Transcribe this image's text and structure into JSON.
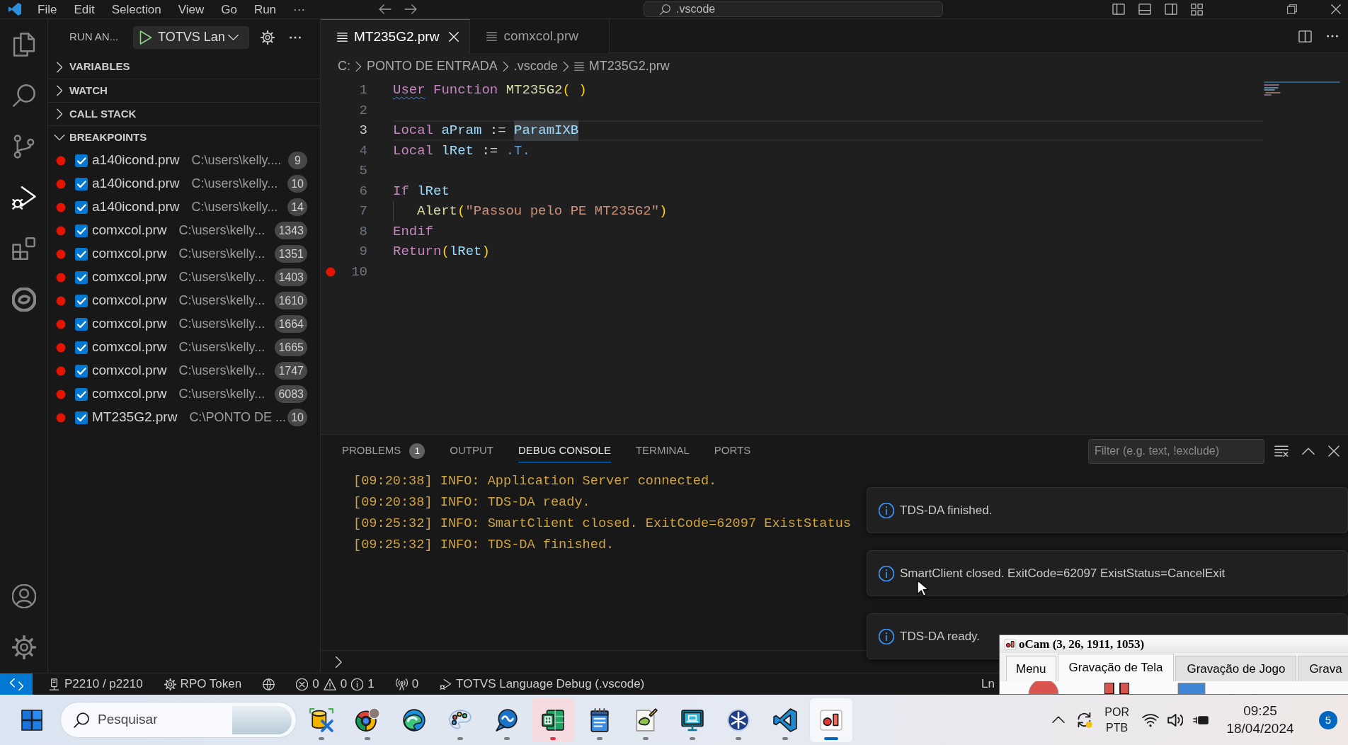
{
  "title_bar": {
    "menus": [
      "File",
      "Edit",
      "Selection",
      "View",
      "Go",
      "Run",
      "···"
    ],
    "command_center": ".vscode"
  },
  "activity_bar": {
    "top": [
      {
        "kind": "explorer",
        "selected": false
      },
      {
        "kind": "search",
        "selected": false
      },
      {
        "kind": "source_control",
        "selected": false
      },
      {
        "kind": "run_debug",
        "selected": true
      },
      {
        "kind": "extensions",
        "selected": false
      },
      {
        "kind": "totvs",
        "selected": false
      }
    ],
    "bottom": [
      {
        "kind": "accounts"
      },
      {
        "kind": "manage"
      }
    ]
  },
  "sidebar": {
    "title": "RUN AN...",
    "launch_config": "TOTVS Lan",
    "sections": [
      {
        "title": "VARIABLES",
        "expanded": false
      },
      {
        "title": "WATCH",
        "expanded": false
      },
      {
        "title": "CALL STACK",
        "expanded": false
      },
      {
        "title": "BREAKPOINTS",
        "expanded": true,
        "breakpoints": [
          {
            "file": "a140icond.prw",
            "path": "C:\\users\\kelly....",
            "line": "9",
            "checked": true
          },
          {
            "file": "a140icond.prw",
            "path": "C:\\users\\kelly...",
            "line": "10",
            "checked": true
          },
          {
            "file": "a140icond.prw",
            "path": "C:\\users\\kelly...",
            "line": "14",
            "checked": true
          },
          {
            "file": "comxcol.prw",
            "path": "C:\\users\\kelly...",
            "line": "1343",
            "checked": true
          },
          {
            "file": "comxcol.prw",
            "path": "C:\\users\\kelly...",
            "line": "1351",
            "checked": true
          },
          {
            "file": "comxcol.prw",
            "path": "C:\\users\\kelly...",
            "line": "1403",
            "checked": true
          },
          {
            "file": "comxcol.prw",
            "path": "C:\\users\\kelly...",
            "line": "1610",
            "checked": true
          },
          {
            "file": "comxcol.prw",
            "path": "C:\\users\\kelly...",
            "line": "1664",
            "checked": true
          },
          {
            "file": "comxcol.prw",
            "path": "C:\\users\\kelly...",
            "line": "1665",
            "checked": true
          },
          {
            "file": "comxcol.prw",
            "path": "C:\\users\\kelly...",
            "line": "1747",
            "checked": true
          },
          {
            "file": "comxcol.prw",
            "path": "C:\\users\\kelly...",
            "line": "6083",
            "checked": true
          },
          {
            "file": "MT235G2.prw",
            "path": "C:\\PONTO DE ...",
            "line": "10",
            "checked": true
          }
        ]
      }
    ]
  },
  "editor": {
    "tabs": [
      {
        "label": "MT235G2.prw",
        "selected": true
      },
      {
        "label": "comxcol.prw",
        "selected": false
      }
    ],
    "breadcrumb": [
      "C:",
      "PONTO DE ENTRADA",
      ".vscode",
      "MT235G2.prw"
    ],
    "lines": [
      {
        "number": "1",
        "current": false,
        "breakpoint": false,
        "indented": false,
        "tokens": [
          {
            "kind": "keyword",
            "text": "User",
            "squiggle": true,
            "highlight": false
          },
          {
            "kind": "keyword",
            "text": " Function",
            "squiggle": false,
            "highlight": false
          },
          {
            "kind": "function",
            "text": " MT235G2",
            "squiggle": false,
            "highlight": false
          },
          {
            "kind": "bracket",
            "text": "(",
            "squiggle": false,
            "highlight": false
          },
          {
            "kind": "bracket",
            "text": " )",
            "squiggle": false,
            "highlight": false
          }
        ]
      },
      {
        "number": "2",
        "current": false,
        "breakpoint": false
      },
      {
        "number": "3",
        "current": true,
        "breakpoint": false,
        "indented": false,
        "tokens": [
          {
            "kind": "keyword",
            "text": "Local",
            "squiggle": false,
            "highlight": false
          },
          {
            "kind": "variable",
            "text": " aPram",
            "squiggle": false,
            "highlight": false
          },
          {
            "kind": "plain",
            "text": " := ",
            "squiggle": false,
            "highlight": false
          },
          {
            "kind": "variable",
            "text": "ParamIXB",
            "squiggle": false,
            "highlight": true
          }
        ]
      },
      {
        "number": "4",
        "current": false,
        "breakpoint": false,
        "indented": false,
        "tokens": [
          {
            "kind": "keyword",
            "text": "Local",
            "squiggle": false,
            "highlight": false
          },
          {
            "kind": "variable",
            "text": " lRet",
            "squiggle": false,
            "highlight": false
          },
          {
            "kind": "plain",
            "text": " := ",
            "squiggle": false,
            "highlight": false
          },
          {
            "kind": "constant",
            "text": ".T.",
            "squiggle": false,
            "highlight": false
          }
        ]
      },
      {
        "number": "5",
        "current": false,
        "breakpoint": false
      },
      {
        "number": "6",
        "current": false,
        "breakpoint": false,
        "indented": false,
        "tokens": [
          {
            "kind": "keyword",
            "text": "If",
            "squiggle": false,
            "highlight": false
          },
          {
            "kind": "variable",
            "text": " lRet",
            "squiggle": false,
            "highlight": false
          }
        ]
      },
      {
        "number": "7",
        "current": false,
        "breakpoint": false,
        "indented": true,
        "tokens": [
          {
            "kind": "function",
            "text": "Alert",
            "squiggle": false,
            "highlight": false
          },
          {
            "kind": "bracket",
            "text": "(",
            "squiggle": false,
            "highlight": false
          },
          {
            "kind": "string",
            "text": "\"Passou pelo PE MT235G2\"",
            "squiggle": false,
            "highlight": false
          },
          {
            "kind": "bracket",
            "text": ")",
            "squiggle": false,
            "highlight": false
          }
        ]
      },
      {
        "number": "8",
        "current": false,
        "breakpoint": false,
        "indented": false,
        "tokens": [
          {
            "kind": "keyword",
            "text": "Endif",
            "squiggle": false,
            "highlight": false
          }
        ]
      },
      {
        "number": "9",
        "current": false,
        "breakpoint": false,
        "indented": false,
        "tokens": [
          {
            "kind": "keyword",
            "text": "Return",
            "squiggle": false,
            "highlight": false
          },
          {
            "kind": "bracket",
            "text": "(",
            "squiggle": false,
            "highlight": false
          },
          {
            "kind": "variable",
            "text": "lRet",
            "squiggle": false,
            "highlight": false
          },
          {
            "kind": "bracket",
            "text": ")",
            "squiggle": false,
            "highlight": false
          }
        ]
      },
      {
        "number": "10",
        "current": false,
        "breakpoint": true
      }
    ]
  },
  "panel": {
    "tabs": [
      {
        "label": "PROBLEMS",
        "count": "1",
        "selected": false
      },
      {
        "label": "OUTPUT",
        "selected": false
      },
      {
        "label": "DEBUG CONSOLE",
        "selected": true
      },
      {
        "label": "TERMINAL",
        "selected": false
      },
      {
        "label": "PORTS",
        "selected": false
      }
    ],
    "filter_placeholder": "Filter (e.g. text, !exclude)",
    "console_lines": [
      "[09:20:38] INFO: Application Server connected.",
      "[09:20:38] INFO: TDS-DA ready.",
      "[09:25:32] INFO: SmartClient closed. ExitCode=62097 ExistStatus",
      "[09:25:32] INFO: TDS-DA finished."
    ]
  },
  "notifications": [
    {
      "message": "TDS-DA finished."
    },
    {
      "message": "SmartClient closed. ExitCode=62097 ExistStatus=CancelExit"
    },
    {
      "message": "TDS-DA ready."
    }
  ],
  "status_bar": {
    "items": [
      {
        "kind": "remote"
      },
      {
        "kind": "server",
        "text": "P2210 / p2210"
      },
      {
        "kind": "gear",
        "text": "RPO Token"
      },
      {
        "kind": "globe"
      },
      {
        "kind": "problems",
        "errors": "0",
        "warnings": "0",
        "infos": "1"
      },
      {
        "kind": "antenna",
        "text": "0"
      },
      {
        "kind": "debug",
        "text": "TOTVS Language Debug (.vscode)"
      }
    ],
    "position": "Ln"
  },
  "ocam_window": {
    "title": "oCam (3, 26, 1911, 1053)",
    "tabs": [
      {
        "label": "Menu",
        "kind": "menu",
        "selected": false
      },
      {
        "label": "Gravação de Tela",
        "kind": "tab",
        "selected": true
      },
      {
        "label": "Gravação de Jogo",
        "kind": "tab",
        "selected": false
      },
      {
        "label": "Grava",
        "kind": "tab",
        "selected": false
      }
    ]
  },
  "taskbar": {
    "search_placeholder": "Pesquisar",
    "apps": [
      {
        "kind": "db_tools",
        "running": true,
        "attention": false,
        "selected": false
      },
      {
        "kind": "chrome",
        "running": true,
        "attention": false,
        "selected": false
      },
      {
        "kind": "edge",
        "running": false,
        "attention": false,
        "selected": false
      },
      {
        "kind": "paint",
        "running": true,
        "attention": false,
        "selected": false
      },
      {
        "kind": "chat",
        "running": true,
        "attention": false,
        "selected": false
      },
      {
        "kind": "excel",
        "running": true,
        "attention": true,
        "selected": false
      },
      {
        "kind": "notepad",
        "running": true,
        "attention": false,
        "selected": false
      },
      {
        "kind": "notepadpp",
        "running": true,
        "attention": false,
        "selected": false
      },
      {
        "kind": "remote_desktop",
        "running": true,
        "attention": false,
        "selected": false
      },
      {
        "kind": "snowflake_app",
        "running": true,
        "attention": false,
        "selected": false
      },
      {
        "kind": "vscode",
        "running": true,
        "attention": false,
        "selected": false
      },
      {
        "kind": "ocam",
        "running": true,
        "attention": false,
        "selected": true
      }
    ],
    "tray": {
      "input_language": "POR",
      "keyboard_layout": "PTB",
      "time": "09:25",
      "date": "18/04/2024",
      "notification_count": "5"
    }
  }
}
